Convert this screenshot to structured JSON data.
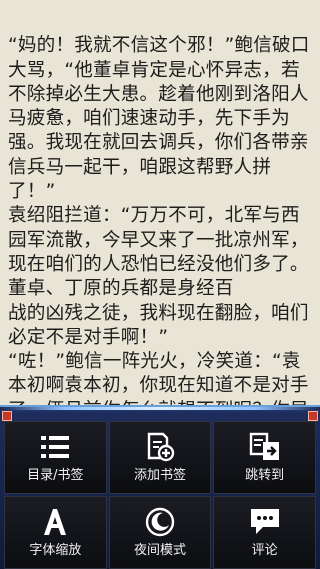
{
  "reader": {
    "paragraphs": [
      "“妈的！我就不信这个邪！”鲍信破口大骂，“他董卓肯定是心怀异志，若不除掉必生大患。趁着他刚到洛阳人马疲惫，咱们速速动手，先下手为强。我现在就回去调兵，你们各带亲信兵马一起干，咱跟这帮野人拼了！”",
      "袁绍阻拦道：“万万不可，北军与西园军流散，今早又来了一批凉州军，现在咱们的人恐怕已经没他们多了。董卓、丁原的兵都是身经百",
      "战的凶残之徒，我料现在翻脸，咱们必定不是对手啊！”",
      "“咗！”鲍信一阵光火，冷笑道：“袁本初啊袁本初，你现在知道不是对手了，俩月前你怎么就想不到呢？你早干什么去了？超"
    ]
  },
  "menu": {
    "items": [
      {
        "label": "目录/书签",
        "icon": "list-icon"
      },
      {
        "label": "添加书签",
        "icon": "add-bookmark-icon"
      },
      {
        "label": "跳转到",
        "icon": "jump-icon"
      },
      {
        "label": "字体缩放",
        "icon": "font-size-icon"
      },
      {
        "label": "夜间模式",
        "icon": "moon-icon"
      },
      {
        "label": "评论",
        "icon": "comment-icon"
      }
    ]
  },
  "colors": {
    "page_bg": "#e8e4d6",
    "menu_bg": "#0c0d11",
    "accent": "#6aa0d8"
  }
}
